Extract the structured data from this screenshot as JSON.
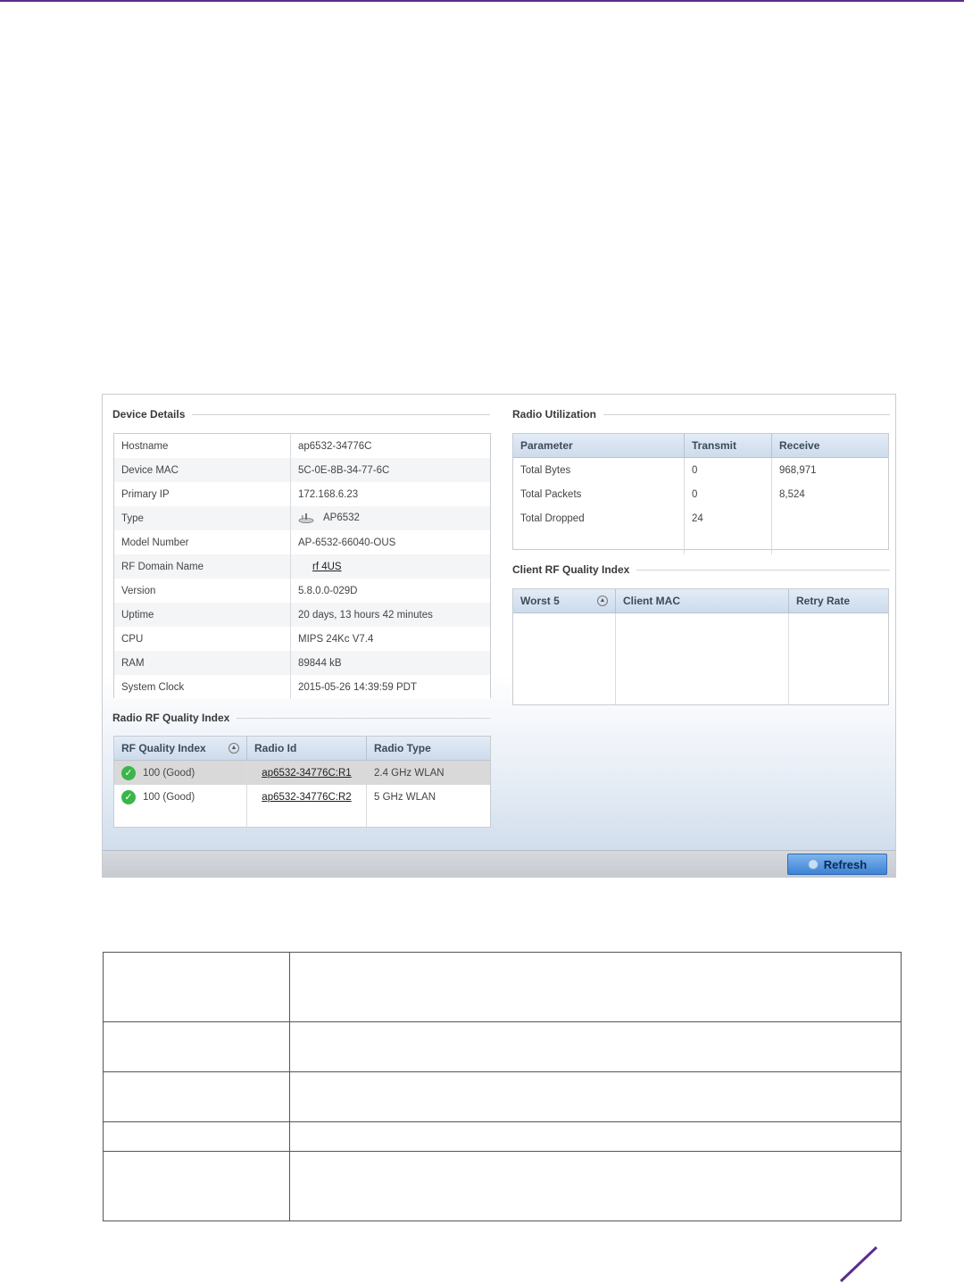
{
  "device_details": {
    "title": "Device Details",
    "rows": [
      {
        "label": "Hostname",
        "value": "ap6532-34776C"
      },
      {
        "label": "Device MAC",
        "value": "5C-0E-8B-34-77-6C"
      },
      {
        "label": "Primary IP",
        "value": "172.168.6.23"
      },
      {
        "label": "Type",
        "value": "AP6532"
      },
      {
        "label": "Model Number",
        "value": "AP-6532-66040-OUS"
      },
      {
        "label": "RF Domain Name",
        "value": "rf 4US"
      },
      {
        "label": "Version",
        "value": "5.8.0.0-029D"
      },
      {
        "label": "Uptime",
        "value": "20 days, 13 hours 42 minutes"
      },
      {
        "label": "CPU",
        "value": "MIPS 24Kc V7.4"
      },
      {
        "label": "RAM",
        "value": "89844 kB"
      },
      {
        "label": "System Clock",
        "value": "2015-05-26 14:39:59 PDT"
      }
    ]
  },
  "radio_rf_quality": {
    "title": "Radio RF Quality Index",
    "columns": [
      "RF Quality Index",
      "Radio Id",
      "Radio Type"
    ],
    "rows": [
      {
        "quality": "100 (Good)",
        "radio_id": "ap6532-34776C:R1",
        "radio_type": "2.4 GHz WLAN"
      },
      {
        "quality": "100 (Good)",
        "radio_id": "ap6532-34776C:R2",
        "radio_type": "5 GHz WLAN"
      }
    ]
  },
  "radio_utilization": {
    "title": "Radio Utilization",
    "columns": [
      "Parameter",
      "Transmit",
      "Receive"
    ],
    "rows": [
      {
        "parameter": "Total Bytes",
        "transmit": "0",
        "receive": "968,971"
      },
      {
        "parameter": "Total Packets",
        "transmit": "0",
        "receive": "8,524"
      },
      {
        "parameter": "Total Dropped",
        "transmit": "24",
        "receive": ""
      }
    ]
  },
  "client_rf_quality": {
    "title": "Client RF Quality Index",
    "columns": [
      "Worst 5",
      "Client MAC",
      "Retry Rate"
    ]
  },
  "footer": {
    "refresh_label": "Refresh"
  },
  "colors": {
    "brand_line": "#5b2d8e",
    "ok_green": "#3ab54a"
  }
}
